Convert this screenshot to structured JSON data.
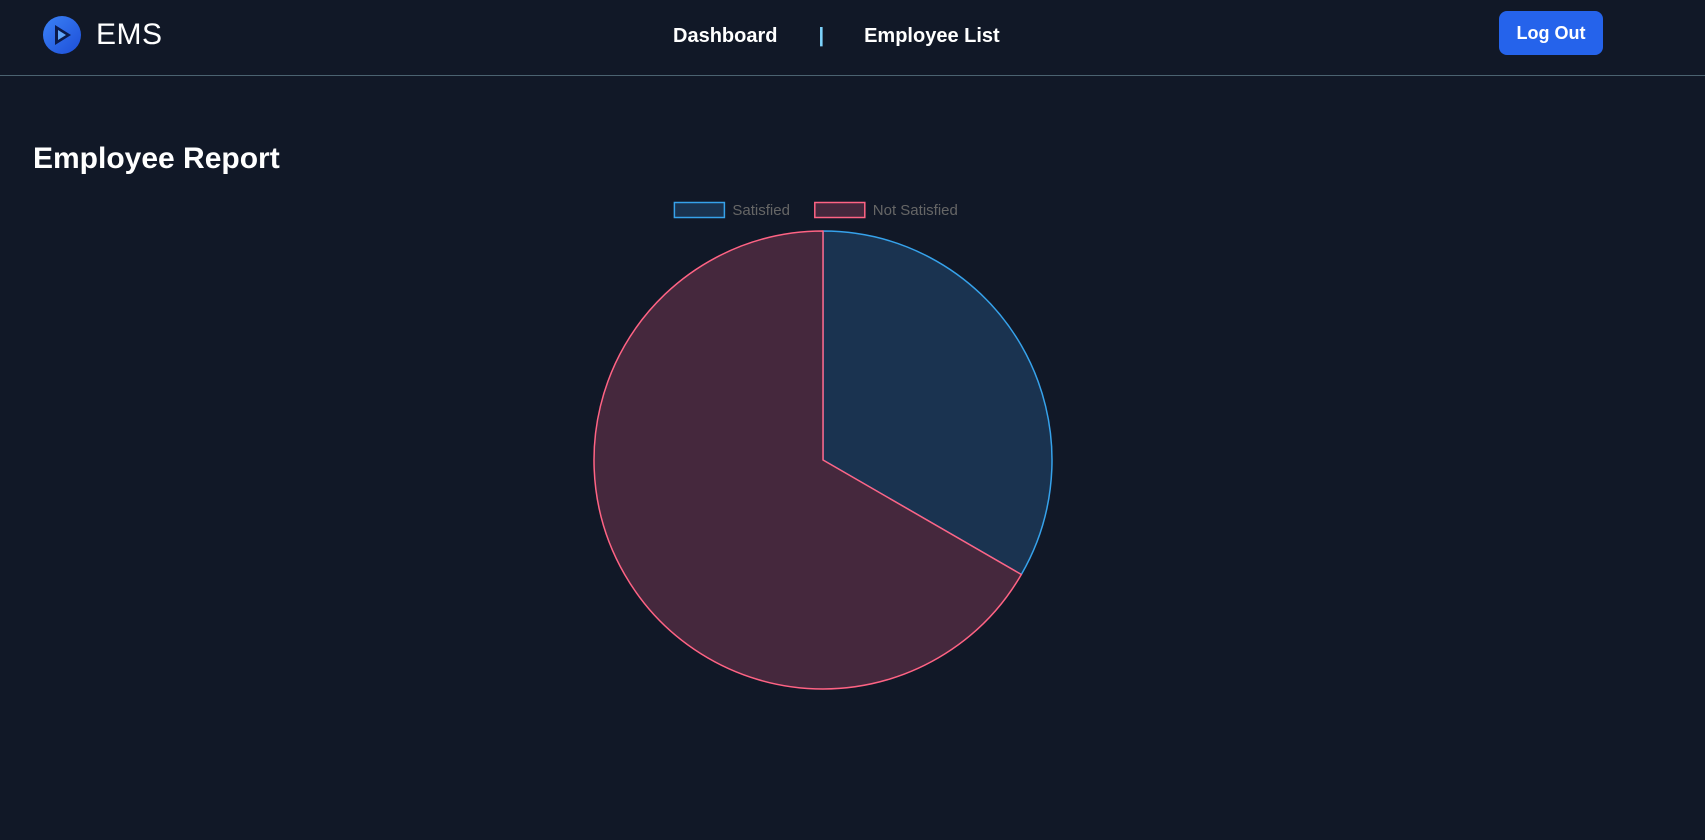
{
  "header": {
    "brand_name": "EMS",
    "logo_icon": "ems-logo-icon",
    "nav": [
      {
        "label": "Dashboard"
      },
      {
        "label": "Employee List"
      }
    ],
    "separator": "|",
    "logout_label": "Log Out"
  },
  "main": {
    "title": "Employee Report"
  },
  "colors": {
    "background": "#111827",
    "accent": "#2563eb"
  },
  "chart_data": {
    "type": "pie",
    "title": "",
    "legend_position": "top-center",
    "categories": [
      "Satisfied",
      "Not Satisfied"
    ],
    "values": [
      1,
      2
    ],
    "colors": {
      "Satisfied": {
        "border": "#36a2eb",
        "fill": "#1a3350"
      },
      "Not Satisfied": {
        "border": "#ff6384",
        "fill": "#45283d"
      }
    }
  }
}
